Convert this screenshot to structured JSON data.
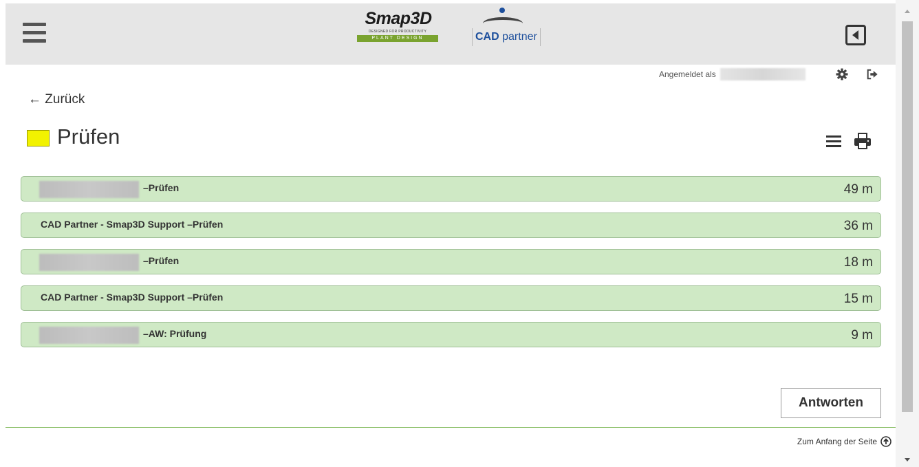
{
  "header": {
    "menu_label": "",
    "logo_smap": {
      "title": "Smap3D",
      "tagline": "DESIGNED FOR PRODUCTIVITY",
      "bar": "PLANT DESIGN"
    },
    "logo_cad": {
      "bold": "CAD",
      "rest": "partner"
    }
  },
  "user": {
    "label": "Angemeldet als"
  },
  "nav": {
    "back": "← Zurück"
  },
  "page": {
    "title": "Prüfen",
    "swatch_color": "#f2f200"
  },
  "messages": [
    {
      "sender_visible": false,
      "subject": "–Prüfen",
      "time": "49 m"
    },
    {
      "sender_visible": true,
      "subject": "CAD Partner - Smap3D Support –Prüfen",
      "time": "36 m"
    },
    {
      "sender_visible": false,
      "subject": "–Prüfen",
      "time": "18 m"
    },
    {
      "sender_visible": true,
      "subject": "CAD Partner - Smap3D Support –Prüfen",
      "time": "15 m"
    },
    {
      "sender_visible": false,
      "subject": "–AW: Prüfung",
      "time": "9 m"
    }
  ],
  "actions": {
    "answer": "Antworten"
  },
  "footer": {
    "to_top": "Zum Anfang der Seite"
  },
  "colors": {
    "message_bg": "#cfe9c5",
    "header_bg": "#e6e6e6",
    "divider": "#8fc26e",
    "brand_green": "#7aa32f",
    "brand_blue": "#1d4f9c"
  }
}
